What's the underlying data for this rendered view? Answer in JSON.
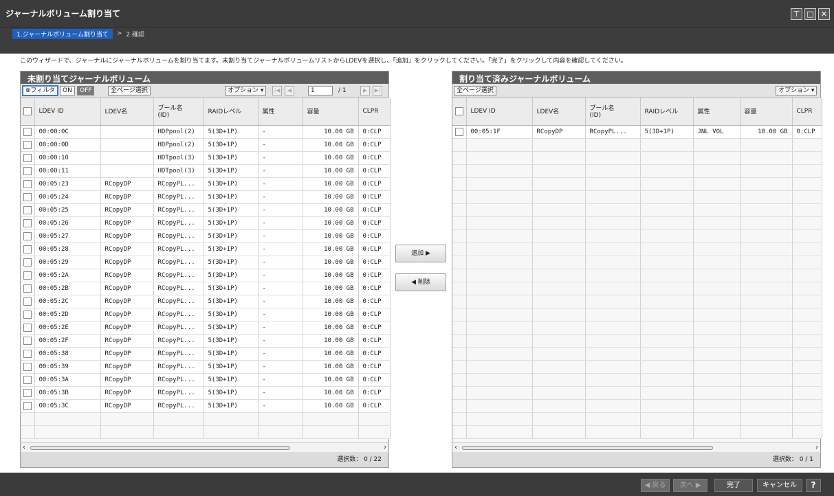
{
  "window": {
    "title": "ジャーナルボリューム割り当て",
    "buttons": [
      "⊤",
      "□",
      "✕"
    ]
  },
  "steps": {
    "active": "1.ジャーナルボリューム割り当て",
    "separator": ">",
    "next": "2.確認"
  },
  "instruction": "このウィザードで、ジャーナルにジャーナルボリュームを割り当てます。未割り当てジャーナルボリュームリストからLDEVを選択し、「追加」をクリックしてください。「完了」をクリックして内容を確認してください。",
  "left_panel": {
    "title": "未割り当てジャーナルボリューム",
    "filter_label": "⊗フィルタ",
    "on_label": "ON",
    "off_label": "OFF",
    "select_all_label": "全ページ選択",
    "options_label": "オプション ▾",
    "page_value": "1",
    "page_total": "/ 1",
    "columns": [
      "LDEV ID",
      "LDEV名",
      "プール名\n(ID)",
      "RAIDレベル",
      "属性",
      "容量",
      "CLPR"
    ],
    "rows": [
      [
        "00:00:0C",
        "",
        "HDPpool(2)",
        "5(3D+1P)",
        "-",
        "10.00 GB",
        "0:CLP"
      ],
      [
        "00:00:0D",
        "",
        "HDPpool(2)",
        "5(3D+1P)",
        "-",
        "10.00 GB",
        "0:CLP"
      ],
      [
        "00:00:10",
        "",
        "HDTpool(3)",
        "5(3D+1P)",
        "-",
        "10.00 GB",
        "0:CLP"
      ],
      [
        "00:00:11",
        "",
        "HDTpool(3)",
        "5(3D+1P)",
        "-",
        "10.00 GB",
        "0:CLP"
      ],
      [
        "00:05:23",
        "RCopyDP",
        "RCopyPL...",
        "5(3D+1P)",
        "-",
        "10.00 GB",
        "0:CLP"
      ],
      [
        "00:05:24",
        "RCopyDP",
        "RCopyPL...",
        "5(3D+1P)",
        "-",
        "10.00 GB",
        "0:CLP"
      ],
      [
        "00:05:25",
        "RCopyDP",
        "RCopyPL...",
        "5(3D+1P)",
        "-",
        "10.00 GB",
        "0:CLP"
      ],
      [
        "00:05:26",
        "RCopyDP",
        "RCopyPL...",
        "5(3D+1P)",
        "-",
        "10.00 GB",
        "0:CLP"
      ],
      [
        "00:05:27",
        "RCopyDP",
        "RCopyPL...",
        "5(3D+1P)",
        "-",
        "10.00 GB",
        "0:CLP"
      ],
      [
        "00:05:28",
        "RCopyDP",
        "RCopyPL...",
        "5(3D+1P)",
        "-",
        "10.00 GB",
        "0:CLP"
      ],
      [
        "00:05:29",
        "RCopyDP",
        "RCopyPL...",
        "5(3D+1P)",
        "-",
        "10.00 GB",
        "0:CLP"
      ],
      [
        "00:05:2A",
        "RCopyDP",
        "RCopyPL...",
        "5(3D+1P)",
        "-",
        "10.00 GB",
        "0:CLP"
      ],
      [
        "00:05:2B",
        "RCopyDP",
        "RCopyPL...",
        "5(3D+1P)",
        "-",
        "10.00 GB",
        "0:CLP"
      ],
      [
        "00:05:2C",
        "RCopyDP",
        "RCopyPL...",
        "5(3D+1P)",
        "-",
        "10.00 GB",
        "0:CLP"
      ],
      [
        "00:05:2D",
        "RCopyDP",
        "RCopyPL...",
        "5(3D+1P)",
        "-",
        "10.00 GB",
        "0:CLP"
      ],
      [
        "00:05:2E",
        "RCopyDP",
        "RCopyPL...",
        "5(3D+1P)",
        "-",
        "10.00 GB",
        "0:CLP"
      ],
      [
        "00:05:2F",
        "RCopyDP",
        "RCopyPL...",
        "5(3D+1P)",
        "-",
        "10.00 GB",
        "0:CLP"
      ],
      [
        "00:05:38",
        "RCopyDP",
        "RCopyPL...",
        "5(3D+1P)",
        "-",
        "10.00 GB",
        "0:CLP"
      ],
      [
        "00:05:39",
        "RCopyDP",
        "RCopyPL...",
        "5(3D+1P)",
        "-",
        "10.00 GB",
        "0:CLP"
      ],
      [
        "00:05:3A",
        "RCopyDP",
        "RCopyPL...",
        "5(3D+1P)",
        "-",
        "10.00 GB",
        "0:CLP"
      ],
      [
        "00:05:3B",
        "RCopyDP",
        "RCopyPL...",
        "5(3D+1P)",
        "-",
        "10.00 GB",
        "0:CLP"
      ],
      [
        "00:05:3C",
        "RCopyDP",
        "RCopyPL...",
        "5(3D+1P)",
        "-",
        "10.00 GB",
        "0:CLP"
      ]
    ],
    "status": "選択数： 0 / 22"
  },
  "middle": {
    "add_label": "追加 ▶",
    "remove_label": "◀ 削除"
  },
  "right_panel": {
    "title": "割り当て済みジャーナルボリューム",
    "select_all_label": "全ページ選択",
    "options_label": "オプション ▾",
    "columns": [
      "LDEV ID",
      "LDEV名",
      "プール名\n(ID)",
      "RAIDレベル",
      "属性",
      "容量",
      "CLPR"
    ],
    "rows": [
      [
        "00:05:1F",
        "RCopyDP",
        "RCopyPL...",
        "5(3D+1P)",
        "JNL VOL",
        "10.00 GB",
        "0:CLP"
      ]
    ],
    "status": "選択数： 0 / 1"
  },
  "footer": {
    "back_label": "◀ 戻る",
    "next_label": "次へ ▶",
    "finish_label": "完了",
    "cancel_label": "キャンセル",
    "help_label": "?"
  }
}
